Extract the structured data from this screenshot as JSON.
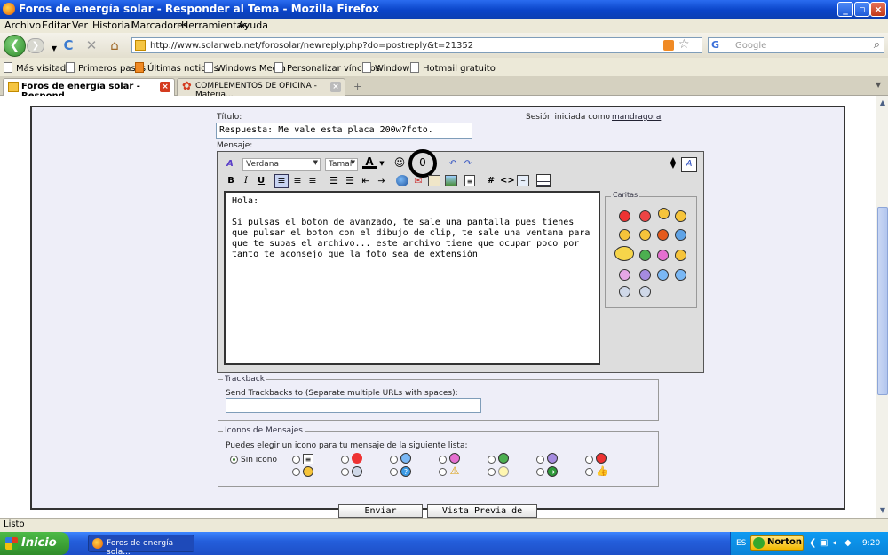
{
  "window": {
    "title": "Foros de energía solar - Responder al Tema - Mozilla Firefox"
  },
  "menu": [
    "Archivo",
    "Editar",
    "Ver",
    "Historial",
    "Marcadores",
    "Herramientas",
    "Ayuda"
  ],
  "nav": {
    "url": "http://www.solarweb.net/forosolar/newreply.php?do=postreply&t=21352",
    "search_placeholder": "Google"
  },
  "bookmarks": [
    "Más visitados",
    "Primeros pasos",
    "Últimas noticias",
    "Windows Media",
    "Personalizar vínculos",
    "Windows",
    "Hotmail gratuito"
  ],
  "tabs": [
    {
      "label": "Foros de energía solar - Respond..."
    },
    {
      "label": "COMPLEMENTOS DE OFICINA - Materia..."
    }
  ],
  "form": {
    "title_label": "Título:",
    "title_value": "Respuesta: Me vale esta placa 200w?foto.",
    "session_text": "Sesión iniciada como",
    "session_user": "mandragora",
    "message_label": "Mensaje:",
    "font_value": "Verdana",
    "size_value": "Tamaí",
    "message_text": "Hola:\n\nSi pulsas el boton de avanzado, te sale una pantalla pues tienes que pulsar el boton con el dibujo de clip, te sale una ventana para que te subas el archivo... este archivo tiene que ocupar poco por tanto te aconsejo que la foto sea de extensión",
    "caritas_label": "Caritas",
    "trackback_legend": "Trackback",
    "trackback_label": "Send Trackbacks to (Separate multiple URLs with spaces):",
    "trackback_value": "",
    "icons_legend": "Iconos de Mensajes",
    "icons_label": "Puedes elegir un icono para tu mensaje de la siguiente lista:",
    "no_icon_label": "Sin icono",
    "submit_label": "Enviar Respuesta",
    "preview_label": "Vista Previa de Mensaje"
  },
  "status": {
    "text": "Listo"
  },
  "taskbar": {
    "start_label": "Inicio",
    "task_label": "Foros de energía sola...",
    "lang": "ES",
    "norton": "Norton",
    "clock": "9:20"
  }
}
